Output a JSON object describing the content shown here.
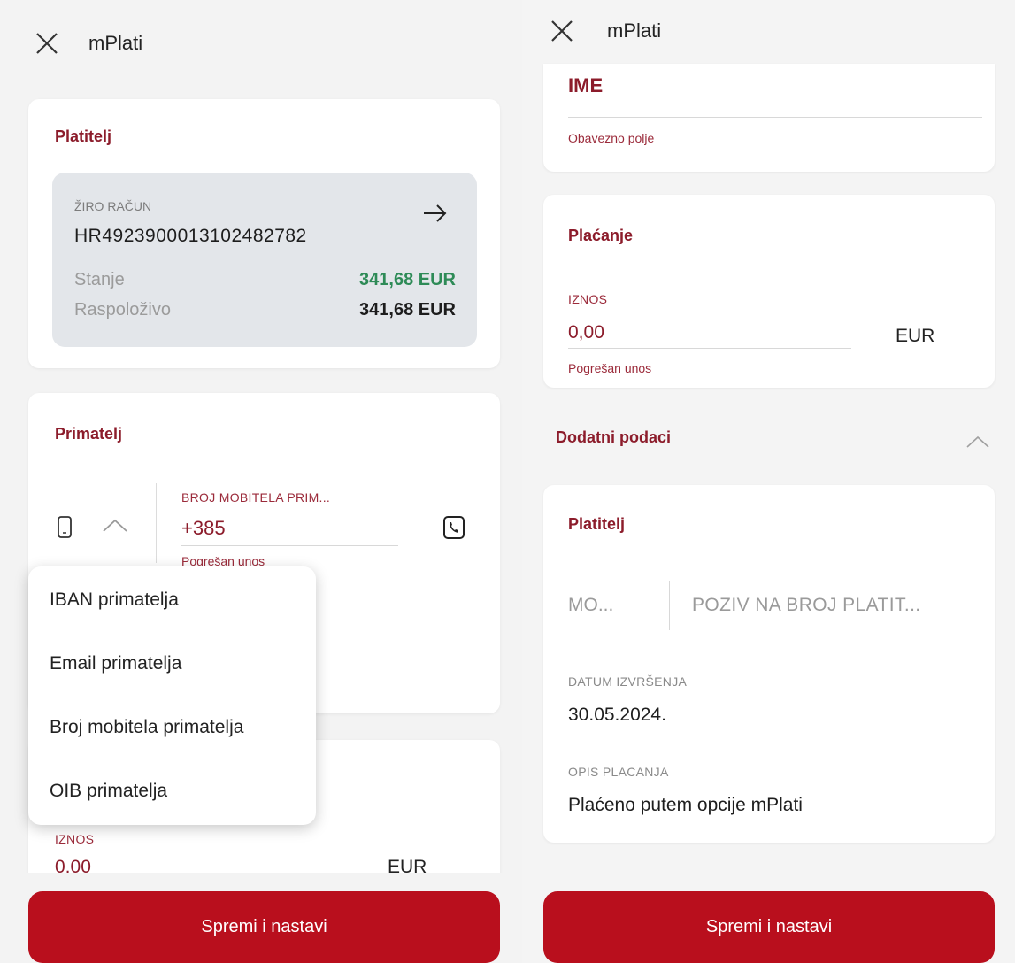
{
  "left": {
    "title": "mPlati",
    "payer": {
      "section_title": "Platitelj",
      "account_type": "ŽIRO RAČUN",
      "iban": "HR4923900013102482782",
      "balance_label": "Stanje",
      "balance_value": "341,68 EUR",
      "available_label": "Raspoloživo",
      "available_value": "341,68 EUR"
    },
    "recipient": {
      "section_title": "Primatelj",
      "field_label": "BROJ MOBITELA PRIM...",
      "field_value": "+385",
      "field_error": "Pogrešan unos"
    },
    "dropdown_items": [
      "IBAN primatelja",
      "Email primatelja",
      "Broj mobitela primatelja",
      "OIB primatelja"
    ],
    "amount_label": "IZNOS",
    "amount_value": "0,00",
    "amount_currency": "EUR",
    "button_label": "Spremi i nastavi"
  },
  "right": {
    "title": "mPlati",
    "name_field_label": "IME",
    "name_field_error": "Obavezno polje",
    "payment": {
      "section_title": "Plaćanje",
      "amount_label": "IZNOS",
      "amount_value": "0,00",
      "currency": "EUR",
      "amount_error": "Pogrešan unos"
    },
    "additional": {
      "section_title": "Dodatni podaci",
      "payer_title": "Platitelj",
      "model_placeholder": "MO...",
      "reference_placeholder": "POZIV NA BROJ PLATIT...",
      "date_label": "DATUM IZVRŠENJA",
      "date_value": "30.05.2024.",
      "description_label": "OPIS PLACANJA",
      "description_value": "Plaćeno putem opcije mPlati"
    },
    "button_label": "Spremi i nastavi"
  },
  "colors": {
    "brand_red": "#b90f1d",
    "label_red": "#8c1c2b",
    "positive_green": "#2e8b57"
  }
}
